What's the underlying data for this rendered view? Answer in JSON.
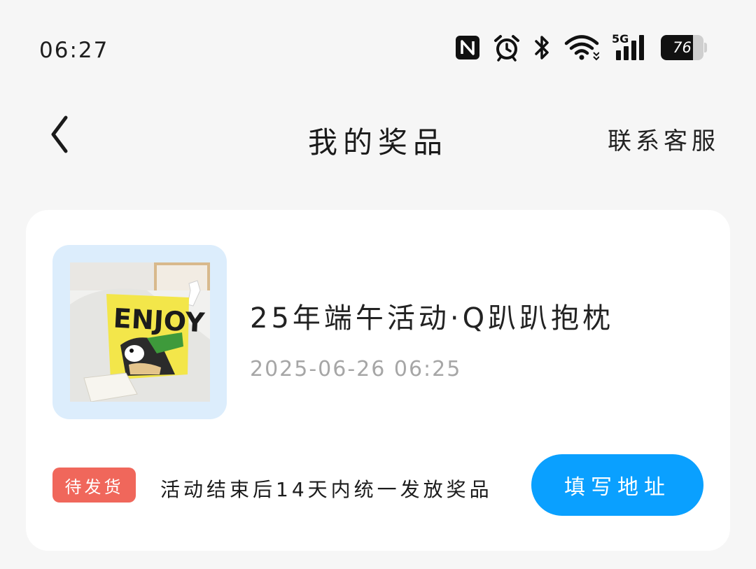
{
  "status_bar": {
    "time": "06:27",
    "network": "5G",
    "battery": "76",
    "battery_level": 0.76,
    "icons": [
      "nfc-icon",
      "alarm-icon",
      "bluetooth-icon",
      "wifi-icon",
      "signal-icon",
      "battery-icon"
    ]
  },
  "nav": {
    "back_icon": "chevron-left-icon",
    "title": "我的奖品",
    "contact": "联系客服"
  },
  "prize": {
    "image_text": "ENJOY",
    "name": "25年端午活动·Q趴趴抱枕",
    "date": "2025-06-26 06:25",
    "status": "待发货",
    "notice": "活动结束后14天内统一发放奖品",
    "action": "填写地址"
  },
  "colors": {
    "background": "#f6f6f6",
    "card": "#ffffff",
    "thumb_frame": "#dcedfc",
    "status_badge": "#f0675b",
    "primary_button": "#0aa0ff",
    "date_text": "#a6a6a6"
  }
}
